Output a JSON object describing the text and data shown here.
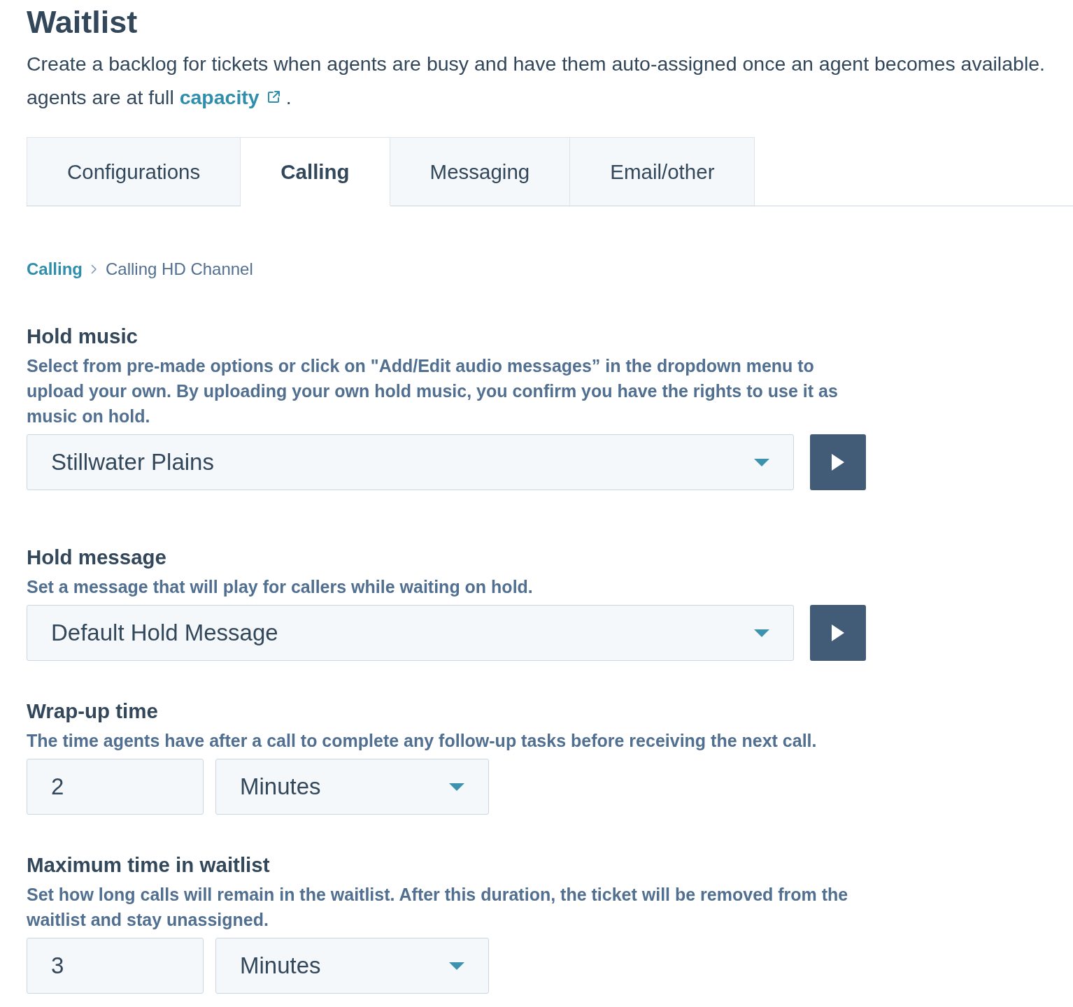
{
  "page": {
    "title": "Waitlist"
  },
  "description": {
    "line_1": "Create a backlog for tickets when agents are busy and have them auto-assigned once an agent becomes available.",
    "line_2": "agents are at full",
    "link": "capacity",
    "end": "."
  },
  "tabs": [
    {
      "label": "Configurations",
      "selected": false
    },
    {
      "label": "Calling",
      "selected": true
    },
    {
      "label": "Messaging",
      "selected": false
    },
    {
      "label": "Email/other",
      "selected": false
    }
  ],
  "breadcrumb": [
    {
      "kind": "link",
      "label": "Calling"
    },
    {
      "kind": "current",
      "label": "Calling HD Channel"
    }
  ],
  "sections": [
    {
      "kind": "audio",
      "title": "Hold music",
      "help": "Select from pre-made options or click on \"Add/Edit audio messages” in the dropdown menu to upload your own. By uploading your own hold music, you confirm you have the rights to use it as music on hold.",
      "select": {
        "value": "Stillwater Plains"
      }
    },
    {
      "kind": "audio",
      "title": "Hold message",
      "help": "Set a message that will play for callers while waiting on hold.",
      "select": {
        "value": "Default Hold Message"
      }
    },
    {
      "kind": "duration",
      "title": "Wrap-up time",
      "help": "The time agents have after a call to complete any follow-up tasks before receiving the next call.",
      "amount": {
        "value": "2"
      },
      "unit": {
        "value": "Minutes"
      }
    },
    {
      "kind": "duration",
      "title": "Maximum time in waitlist",
      "help": "Set how long calls will remain in the waitlist. After this duration, the ticket will be removed from the waitlist and stay unassigned.",
      "amount": {
        "value": "3"
      },
      "unit": {
        "value": "Minutes"
      }
    }
  ]
}
